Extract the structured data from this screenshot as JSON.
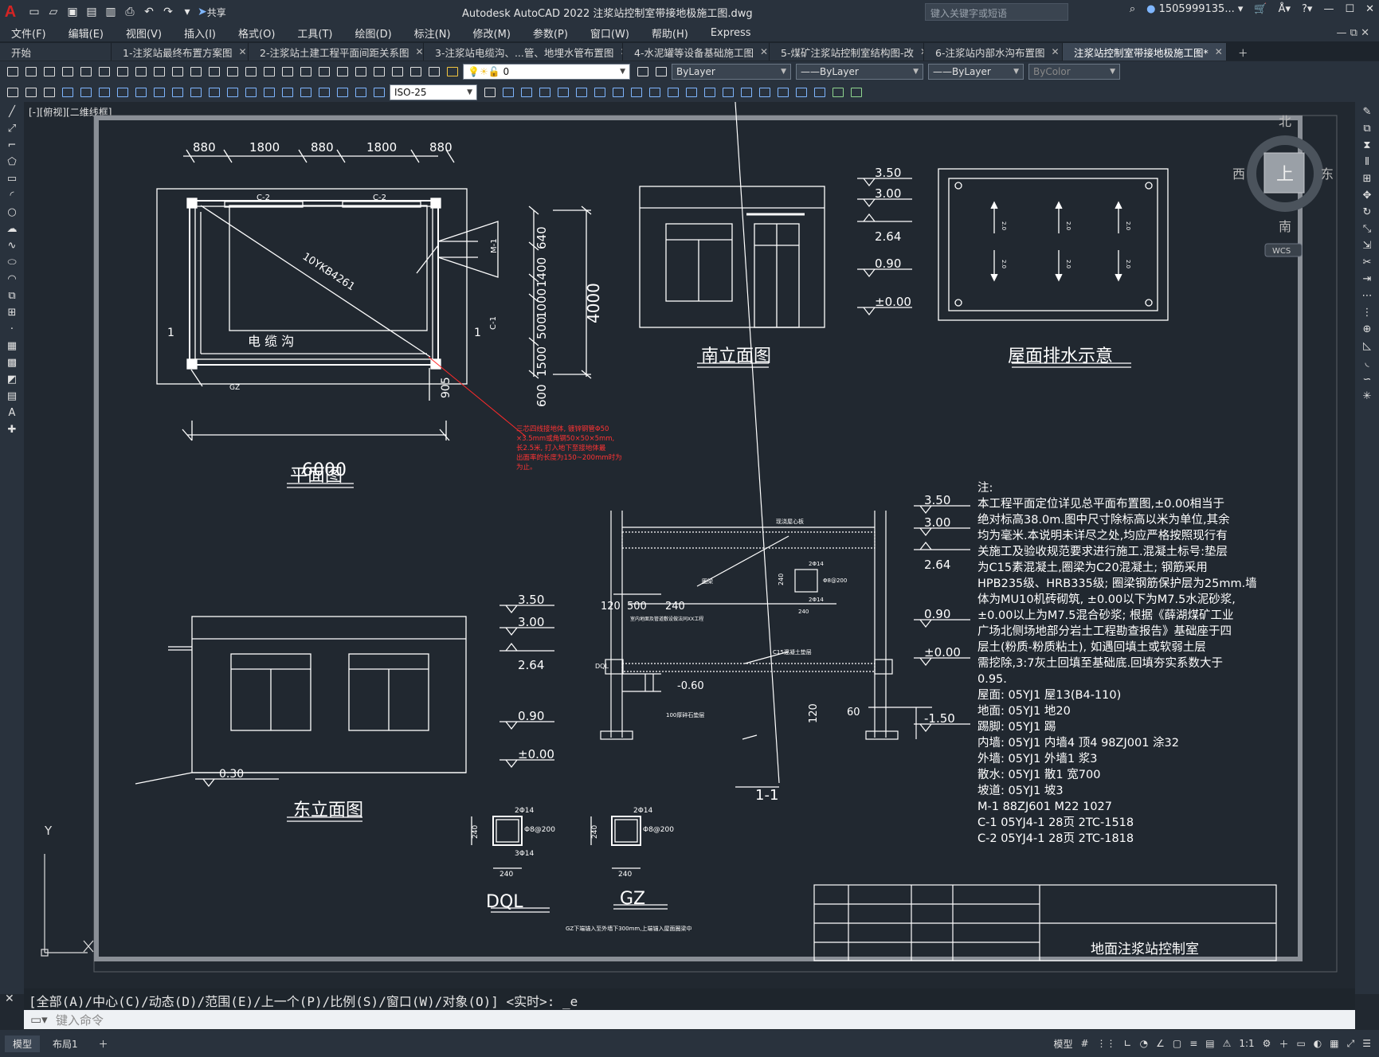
{
  "app": {
    "logo": "A",
    "title": "Autodesk AutoCAD 2022    注浆站控制室带接地极施工图.dwg",
    "search_placeholder": "键入关键字或短语",
    "user": "1505999135...",
    "share": "共享"
  },
  "menu": [
    "文件(F)",
    "编辑(E)",
    "视图(V)",
    "插入(I)",
    "格式(O)",
    "工具(T)",
    "绘图(D)",
    "标注(N)",
    "修改(M)",
    "参数(P)",
    "窗口(W)",
    "帮助(H)",
    "Express"
  ],
  "tabs": [
    {
      "label": "开始",
      "active": false
    },
    {
      "label": "1-注浆站最终布置方案图",
      "active": false
    },
    {
      "label": "2-注浆站土建工程平面间距关系图",
      "active": false
    },
    {
      "label": "3-注浆站电缆沟、...管、地埋水管布置图",
      "active": false
    },
    {
      "label": "4-水泥罐等设备基础施工图",
      "active": false
    },
    {
      "label": "5-煤矿注浆站控制室结构图-改",
      "active": false
    },
    {
      "label": "6-注浆站内部水沟布置图",
      "active": false
    },
    {
      "label": "注浆站控制室带接地极施工图*",
      "active": true
    }
  ],
  "toolbar": {
    "layer": "0",
    "color": "ByLayer",
    "linetype": "ByLayer",
    "lineweight": "ByLayer",
    "plotstyle": "ByColor",
    "dimstyle": "ISO-25"
  },
  "viewport": {
    "label": "[-][俯视][二维线框]",
    "viewcube": {
      "north": "北",
      "south": "南",
      "east": "东",
      "west": "西",
      "top": "上",
      "wcs": "WCS"
    }
  },
  "drawing": {
    "plan": {
      "title": "平面图",
      "dims_top": [
        "880",
        "1800",
        "880",
        "1800",
        "880"
      ],
      "dim_bottom": "6000",
      "windows": [
        "C-2",
        "C-2"
      ],
      "side_window": "C-1",
      "door": "M-1",
      "section_mark": "1",
      "diag_label": "10YKB4261",
      "trench_label": "电     缆     沟",
      "gz": "GZ",
      "dim_905": "905",
      "dims_right": [
        "640",
        "1400",
        "1000",
        "500",
        "1500",
        "600"
      ],
      "dim_right_total": "4000",
      "note_red": [
        "三芯四线接地体, 镀锌钢管Φ50",
        "×3.5mm或角钢50×50×5mm,",
        "长2.5米, 打入地下至接地体最",
        "出面率的长度为150~200mm时为",
        "为止。"
      ]
    },
    "south_elev": {
      "title": "南立面图"
    },
    "roof": {
      "title": "屋面排水示意",
      "slopes": [
        "2.0",
        "2.0",
        "2.0",
        "2.0",
        "2.0",
        "2.0"
      ]
    },
    "levels": [
      "3.50",
      "3.00",
      "2.64",
      "0.90",
      "±0.00"
    ],
    "levels_section_extra": "-1.50",
    "east_elev": {
      "title": "东立面图",
      "ground": "0.30"
    },
    "section": {
      "title": "1-1",
      "dims": [
        "120",
        "500",
        "240"
      ],
      "labels": [
        "现浇屋心板",
        "圈梁",
        "C15混凝土垫层",
        "DQL",
        "-0.60",
        "100厚碎石垫层",
        "室内地面及管道敷设做法同XX工程",
        "120",
        "60"
      ],
      "beam": [
        "2Φ14",
        "Φ8@200",
        "2Φ14",
        "240",
        "240"
      ]
    },
    "dql": {
      "title": "DQL",
      "top": "2Φ14",
      "stirrup": "Φ8@200",
      "bottom": "3Φ14",
      "w": "240",
      "h": "240"
    },
    "gz_detail": {
      "title": "GZ",
      "top": "2Φ14",
      "stirrup": "Φ8@200",
      "w": "240",
      "h": "240",
      "note": "GZ下端锚入至外墙下300mm,上端锚入屋面圈梁中"
    },
    "notes": [
      "注:",
      "本工程平面定位详见总平面布置图,±0.00相当于",
      "绝对标高38.0m.图中尺寸除标高以米为单位,其余",
      "均为毫米.本说明未详尽之处,均应严格按照现行有",
      "关施工及验收规范要求进行施工.混凝土标号:垫层",
      "为C15素混凝土,圈梁为C20混凝土; 钢筋采用",
      "HPB235级、HRB335级; 圈梁钢筋保护层为25mm.墙",
      "体为MU10机砖砌筑, ±0.00以下为M7.5水泥砂浆,",
      "±0.00以上为M7.5混合砂浆; 根据《薛湖煤矿工业",
      "广场北侧场地部分岩土工程勘查报告》基础座于四",
      "层土(粉质-粉质粘土), 如遇回填土或软弱土层",
      "需挖除,3:7灰土回填至基础底.回填夯实系数大于",
      "0.95.",
      "屋面: 05YJ1 屋13(B4-110)",
      "地面: 05YJ1 地20",
      "踢脚: 05YJ1 踢",
      "内墙: 05YJ1 内墙4  顶4 98ZJ001 涂32",
      "外墙: 05YJ1 外墙1  浆3",
      "散水: 05YJ1  散1 宽700",
      "坡道: 05YJ1  坡3",
      "M-1  88ZJ601 M22 1027",
      "C-1  05YJ4-1 28页   2TC-1518",
      "C-2  05YJ4-1 28页   2TC-1818"
    ],
    "title_block": "地面注浆站控制室",
    "ucs": {
      "y": "Y",
      "x": "X"
    }
  },
  "command": {
    "history": "[全部(A)/中心(C)/动态(D)/范围(E)/上一个(P)/比例(S)/窗口(W)/对象(O)] <实时>: _e",
    "placeholder": "键入命令"
  },
  "status": {
    "tabs": [
      "模型",
      "布局1"
    ],
    "model": "模型",
    "scale": "1:1"
  }
}
